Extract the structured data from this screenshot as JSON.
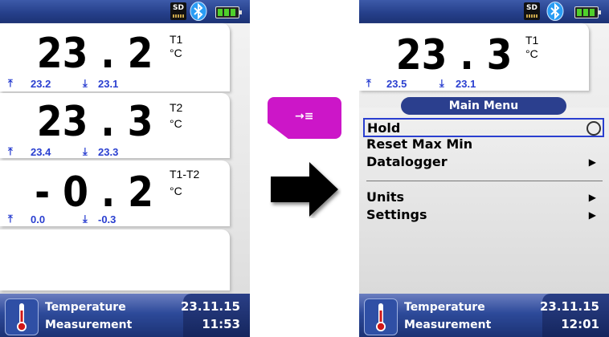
{
  "left_screen": {
    "status": {
      "sd_label": "SD",
      "bluetooth_icon": "bluetooth-icon",
      "battery_icon": "battery-icon"
    },
    "channels": [
      {
        "value": "23 . 2",
        "name": "T1",
        "unit": "°C",
        "max": "23.2",
        "min": "23.1"
      },
      {
        "value": "23 . 3",
        "name": "T2",
        "unit": "°C",
        "max": "23.4",
        "min": "23.3"
      },
      {
        "value": "- 0 . 2",
        "name": "T1-T2",
        "unit": "°C",
        "max": "0.0",
        "min": "-0.3"
      }
    ],
    "footer": {
      "title_line1": "Temperature",
      "title_line2": "Measurement",
      "date": "23.11.15",
      "time": "11:53"
    }
  },
  "hotkey": {
    "icon": "menu-key-icon",
    "glyph": "→≡",
    "color": "#cc16c8"
  },
  "transition_arrow": {
    "icon": "right-arrow-icon"
  },
  "right_screen": {
    "status": {
      "sd_label": "SD",
      "bluetooth_icon": "bluetooth-icon",
      "battery_icon": "battery-icon"
    },
    "channel": {
      "value": "23 . 3",
      "name": "T1",
      "unit": "°C",
      "max": "23.5",
      "min": "23.1"
    },
    "menu": {
      "title": "Main Menu",
      "items": [
        {
          "label": "Hold",
          "selected": true,
          "marker": "radio"
        },
        {
          "label": "Reset Max Min",
          "marker": ""
        },
        {
          "label": "Datalogger",
          "marker": "▶"
        },
        {
          "label": "Units",
          "marker": "▶"
        },
        {
          "label": "Settings",
          "marker": "▶"
        }
      ]
    },
    "footer": {
      "title_line1": "Temperature",
      "title_line2": "Measurement",
      "date": "23.11.15",
      "time": "12:01"
    }
  },
  "colors": {
    "statusbar": "#26408b",
    "minmax": "#2a3fd0",
    "selection": "#2a3fd0",
    "battery": "#4fd12b"
  }
}
